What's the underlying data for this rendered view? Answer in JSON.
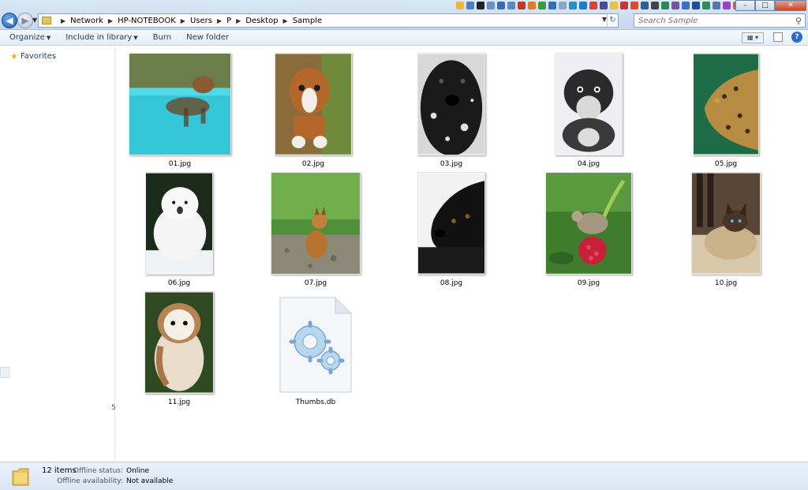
{
  "address": {
    "crumbs": [
      "Network",
      "HP-NOTEBOOK",
      "Users",
      "P",
      "Desktop",
      "Sample"
    ]
  },
  "search": {
    "placeholder": "Search Sample"
  },
  "toolbar": {
    "organize": "Organize",
    "include_in_library": "Include in library",
    "burn": "Burn",
    "new_folder": "New folder"
  },
  "navpane": {
    "favorites": "Favorites",
    "scroll_mark": "5"
  },
  "files": [
    {
      "name": "01.jpg",
      "icon": "pool-dog-photo",
      "c1": "#35c6d8",
      "c2": "#6a4a2a"
    },
    {
      "name": "02.jpg",
      "icon": "boxer-puppy-photo",
      "c1": "#b5672b",
      "c2": "#f2efe9"
    },
    {
      "name": "03.jpg",
      "icon": "black-dog-snow-photo",
      "c1": "#1a1a1a",
      "c2": "#e0e0e0"
    },
    {
      "name": "04.jpg",
      "icon": "schnauzer-puppy-photo",
      "c1": "#2a2a2a",
      "c2": "#efeef2"
    },
    {
      "name": "05.jpg",
      "icon": "leopard-photo",
      "c1": "#1d6b47",
      "c2": "#b88b43"
    },
    {
      "name": "06.jpg",
      "icon": "white-puppy-photo",
      "c1": "#1c2a1c",
      "c2": "#f5f5f5"
    },
    {
      "name": "07.jpg",
      "icon": "fox-cub-photo",
      "c1": "#4f8f3a",
      "c2": "#b8742f"
    },
    {
      "name": "08.jpg",
      "icon": "black-labrador-photo",
      "c1": "#f2f2f2",
      "c2": "#111111"
    },
    {
      "name": "09.jpg",
      "icon": "mouse-raspberry-photo",
      "c1": "#3f7d2c",
      "c2": "#c8203a"
    },
    {
      "name": "10.jpg",
      "icon": "siamese-cat-photo",
      "c1": "#5a4636",
      "c2": "#d8c7a8"
    },
    {
      "name": "11.jpg",
      "icon": "barn-owl-photo",
      "c1": "#2f4a22",
      "c2": "#e9dccb"
    },
    {
      "name": "Thumbs.db",
      "icon": "system-file-gears-icon",
      "c1": "#eef2f7",
      "c2": "#9fc3e6"
    }
  ],
  "status": {
    "count": "12 items",
    "offline_status_label": "Offline status:",
    "offline_status_value": "Online",
    "offline_availability_label": "Offline availability:",
    "offline_availability_value": "Not available"
  }
}
